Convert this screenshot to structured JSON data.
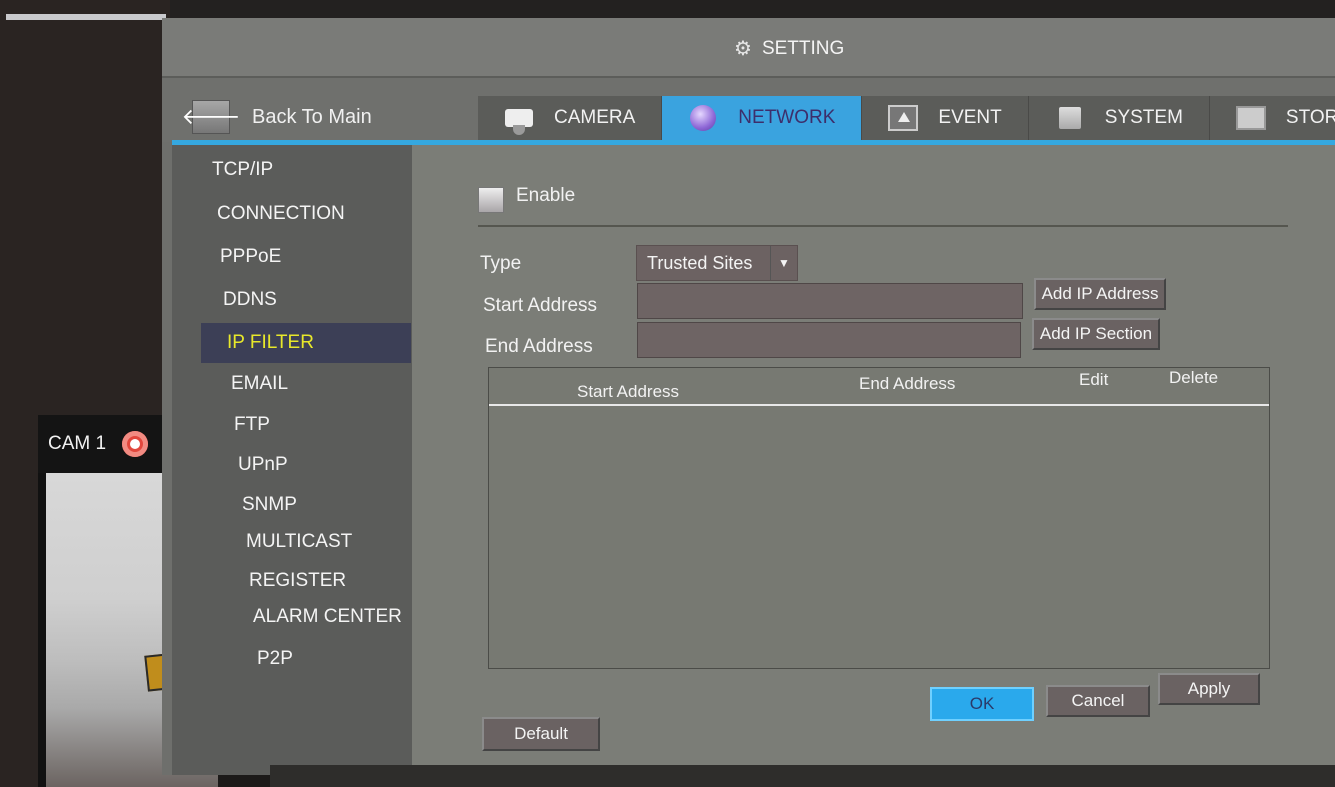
{
  "window": {
    "title": "SETTING",
    "title_icon": "gear-icon"
  },
  "nav": {
    "back_label": "Back To Main",
    "back_icon": "arrow-left-icon",
    "tabs": [
      {
        "label": "CAMERA",
        "icon": "camera-icon",
        "active": false
      },
      {
        "label": "NETWORK",
        "icon": "globe-icon",
        "active": true
      },
      {
        "label": "EVENT",
        "icon": "event-icon",
        "active": false
      },
      {
        "label": "SYSTEM",
        "icon": "system-icon",
        "active": false
      },
      {
        "label": "STORAGE",
        "icon": "storage-icon",
        "active": false
      }
    ]
  },
  "sidebar": {
    "items": [
      {
        "label": "TCP/IP"
      },
      {
        "label": "CONNECTION"
      },
      {
        "label": "PPPoE"
      },
      {
        "label": "DDNS"
      },
      {
        "label": "IP FILTER",
        "active": true
      },
      {
        "label": "EMAIL"
      },
      {
        "label": "FTP"
      },
      {
        "label": "UPnP"
      },
      {
        "label": "SNMP"
      },
      {
        "label": "MULTICAST"
      },
      {
        "label": "REGISTER"
      },
      {
        "label": "ALARM CENTER"
      },
      {
        "label": "P2P"
      }
    ]
  },
  "form": {
    "enable_label": "Enable",
    "enable_checked": false,
    "type_label": "Type",
    "type_value": "Trusted Sites",
    "start_label": "Start Address",
    "start_value": "",
    "end_label": "End Address",
    "end_value": "",
    "add_ip_address": "Add IP Address",
    "add_ip_section": "Add IP Section"
  },
  "table": {
    "columns": [
      "Start Address",
      "End Address",
      "Edit",
      "Delete"
    ],
    "rows": []
  },
  "actions": {
    "default": "Default",
    "ok": "OK",
    "cancel": "Cancel",
    "apply": "Apply"
  },
  "camera_preview": {
    "label": "CAM 1",
    "record_icon": "record-icon",
    "status_icon": "help-icon"
  },
  "colors": {
    "accent": "#35a8e0",
    "active_item_text": "#e8e82a",
    "active_item_bg": "#3c3f56"
  }
}
